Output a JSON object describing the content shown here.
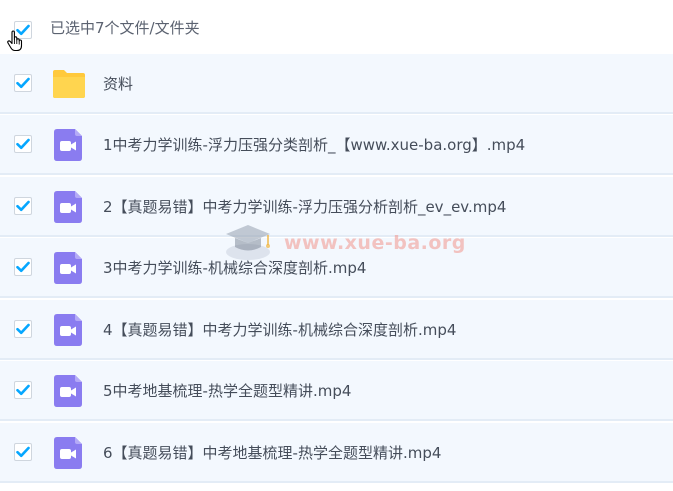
{
  "header": {
    "selection_text": "已选中7个文件/文件夹",
    "select_all_checked": true
  },
  "colors": {
    "check_blue": "#06a7ff",
    "folder_yellow": "#ffd14c",
    "video_purple": "#8a7cf0",
    "row_bg": "#f3f8fe"
  },
  "files": [
    {
      "type": "folder",
      "icon": "folder-icon",
      "name": "资料",
      "checked": true
    },
    {
      "type": "video",
      "icon": "video-icon",
      "name": "1中考力学训练-浮力压强分类剖析_【www.xue-ba.org】.mp4",
      "checked": true
    },
    {
      "type": "video",
      "icon": "video-icon",
      "name": "2【真题易错】中考力学训练-浮力压强分析剖析_ev_ev.mp4",
      "checked": true
    },
    {
      "type": "video",
      "icon": "video-icon",
      "name": "3中考力学训练-机械综合深度剖析.mp4",
      "checked": true
    },
    {
      "type": "video",
      "icon": "video-icon",
      "name": "4【真题易错】中考力学训练-机械综合深度剖析.mp4",
      "checked": true
    },
    {
      "type": "video",
      "icon": "video-icon",
      "name": "5中考地基梳理-热学全题型精讲.mp4",
      "checked": true
    },
    {
      "type": "video",
      "icon": "video-icon",
      "name": "6【真题易错】中考地基梳理-热学全题型精讲.mp4",
      "checked": true
    }
  ],
  "watermark": {
    "text": "www.xue-ba.org"
  }
}
